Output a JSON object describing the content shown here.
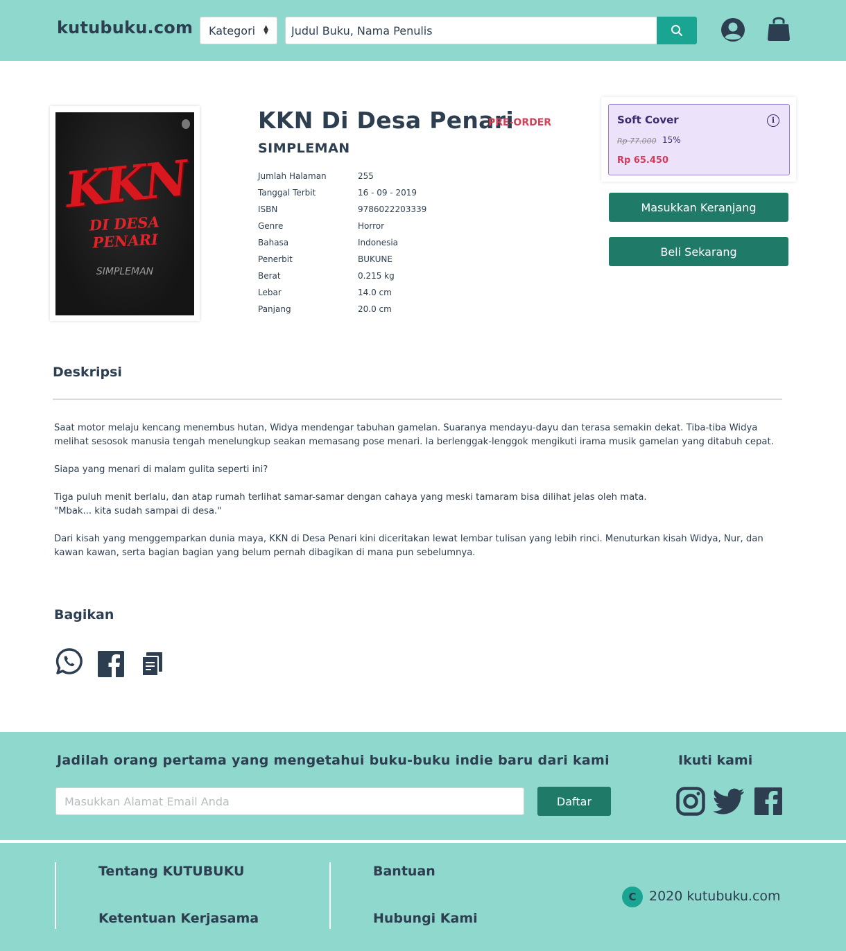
{
  "header": {
    "logo": "kutubuku.com",
    "category_label": "Kategori",
    "search_placeholder": "Judul Buku, Nama Penulis"
  },
  "product": {
    "title": "KKN Di Desa Penari",
    "badge": "PRE-ORDER",
    "author": "SIMPLEMAN",
    "cover": {
      "title_text": "KKN",
      "subtitle_text": "DI DESA PENARI",
      "author_text": "SIMPLEMAN"
    },
    "specs": [
      {
        "label": "Jumlah Halaman",
        "value": "255"
      },
      {
        "label": "Tanggal Terbit",
        "value": "16 - 09 - 2019"
      },
      {
        "label": "ISBN",
        "value": "9786022203339"
      },
      {
        "label": "Genre",
        "value": "Horror"
      },
      {
        "label": "Bahasa",
        "value": "Indonesia"
      },
      {
        "label": "Penerbit",
        "value": "BUKUNE"
      },
      {
        "label": "Berat",
        "value": "0.215 kg"
      },
      {
        "label": "Lebar",
        "value": "14.0 cm"
      },
      {
        "label": "Panjang",
        "value": "20.0 cm"
      }
    ],
    "format": {
      "name": "Soft Cover",
      "info_glyph": "i",
      "old_price": "Rp 77.000",
      "discount": "15%",
      "price": "Rp 65.450"
    },
    "add_to_cart": "Masukkan Keranjang",
    "buy_now": "Beli Sekarang"
  },
  "description": {
    "title": "Deskripsi",
    "paragraphs": [
      "Saat motor melaju kencang menembus hutan, Widya mendengar tabuhan gamelan. Suaranya mendayu-dayu dan terasa semakin dekat. Tiba-tiba Widya melihat sesosok manusia tengah menelungkup seakan memasang pose menari. Ia berlenggak-lenggok mengikuti irama musik gamelan yang ditabuh cepat.",
      "Siapa yang menari di malam gulita seperti ini?",
      "Tiga puluh menit berlalu, dan atap rumah terlihat samar-samar dengan cahaya yang meski tamaram bisa dilihat jelas oleh mata.",
      "\"Mbak... kita sudah sampai di desa.\"",
      "Dari kisah yang menggemparkan dunia maya, KKN di Desa Penari kini diceritakan lewat lembar tulisan yang lebih rinci. Menuturkan kisah Widya, Nur, dan kawan kawan, serta bagian bagian yang belum pernah dibagikan di mana pun sebelumnya."
    ]
  },
  "share": {
    "title": "Bagikan"
  },
  "newsletter": {
    "title": "Jadilah orang pertama yang mengetahui buku-buku indie baru dari kami",
    "email_placeholder": "Masukkan Alamat Email Anda",
    "button": "Daftar",
    "follow_title": "Ikuti kami"
  },
  "footer": {
    "links": [
      "Tentang KUTUBUKU",
      "Ketentuan Kerjasama",
      "Bantuan",
      "Hubungi Kami"
    ],
    "copyright_mark": "C",
    "copyright": "2020 kutubuku.com"
  },
  "colors": {
    "teal_bg": "#8fd8cd",
    "accent": "#1aa592",
    "button": "#207a68",
    "preorder": "#d34257",
    "format_bg": "#ece3fa"
  }
}
